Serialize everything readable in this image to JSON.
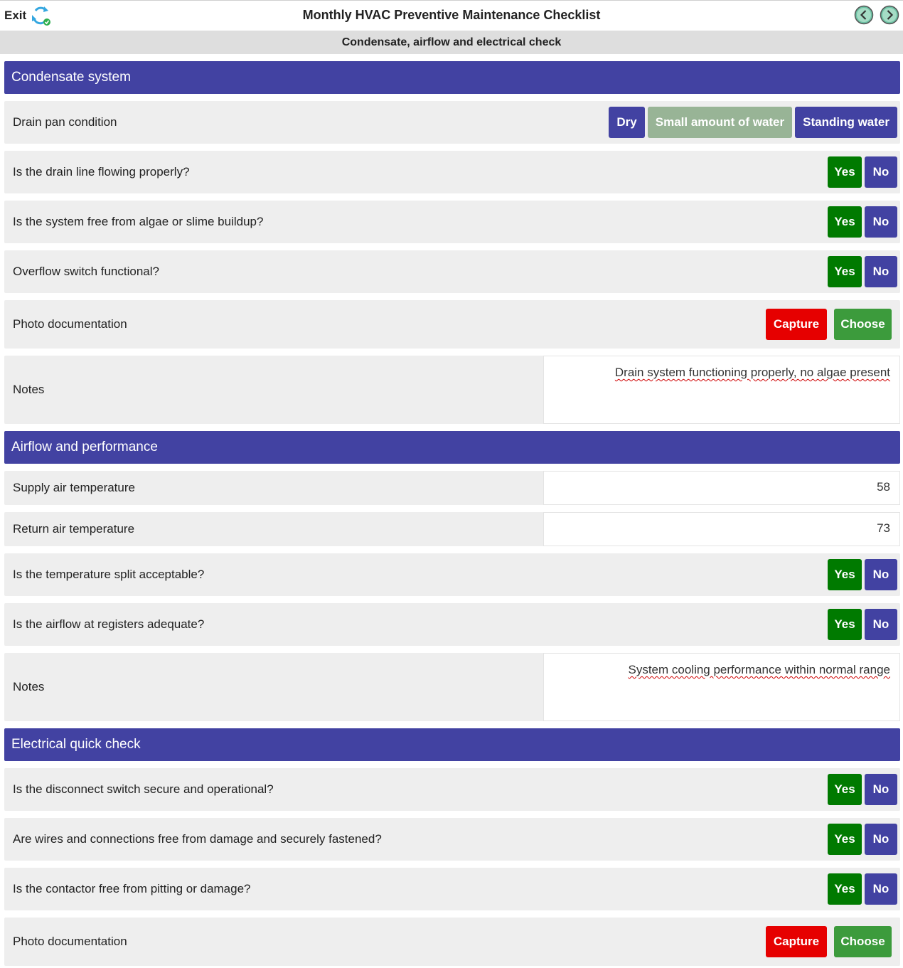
{
  "header": {
    "exit_label": "Exit",
    "title": "Monthly HVAC Preventive Maintenance Checklist",
    "subtitle": "Condensate, airflow and electrical check",
    "sync_icon": "sync-icon",
    "prev_icon": "chevron-left-icon",
    "next_icon": "chevron-right-icon"
  },
  "colors": {
    "section_header": "#4242a2",
    "yes": "#007a00",
    "no": "#4242a2",
    "selected_option": "#98b496",
    "capture": "#e60000",
    "choose": "#3c9b3c"
  },
  "sections": [
    {
      "title": "Condensate system",
      "drain_pan": {
        "label": "Drain pan condition",
        "options": [
          "Dry",
          "Small amount of water",
          "Standing water"
        ],
        "selected": "Small amount of water"
      },
      "questions": [
        "Is the drain line flowing properly?",
        "Is the system free from algae or slime buildup?",
        "Overflow switch functional?"
      ],
      "photo_label": "Photo documentation",
      "notes_label": "Notes",
      "notes_value": "Drain system functioning properly, no algae present"
    },
    {
      "title": "Airflow and performance",
      "supply_label": "Supply air temperature",
      "supply_value": "58",
      "return_label": "Return air temperature",
      "return_value": "73",
      "questions": [
        "Is the temperature split acceptable?",
        "Is the airflow at registers adequate?"
      ],
      "notes_label": "Notes",
      "notes_value": "System cooling performance within normal range"
    },
    {
      "title": "Electrical quick check",
      "questions": [
        "Is the disconnect switch secure and operational?",
        "Are wires and connections free from damage and securely fastened?",
        "Is the contactor free from pitting or damage?"
      ],
      "photo_label": "Photo documentation"
    }
  ],
  "buttons": {
    "yes": "Yes",
    "no": "No",
    "capture": "Capture",
    "choose": "Choose"
  }
}
